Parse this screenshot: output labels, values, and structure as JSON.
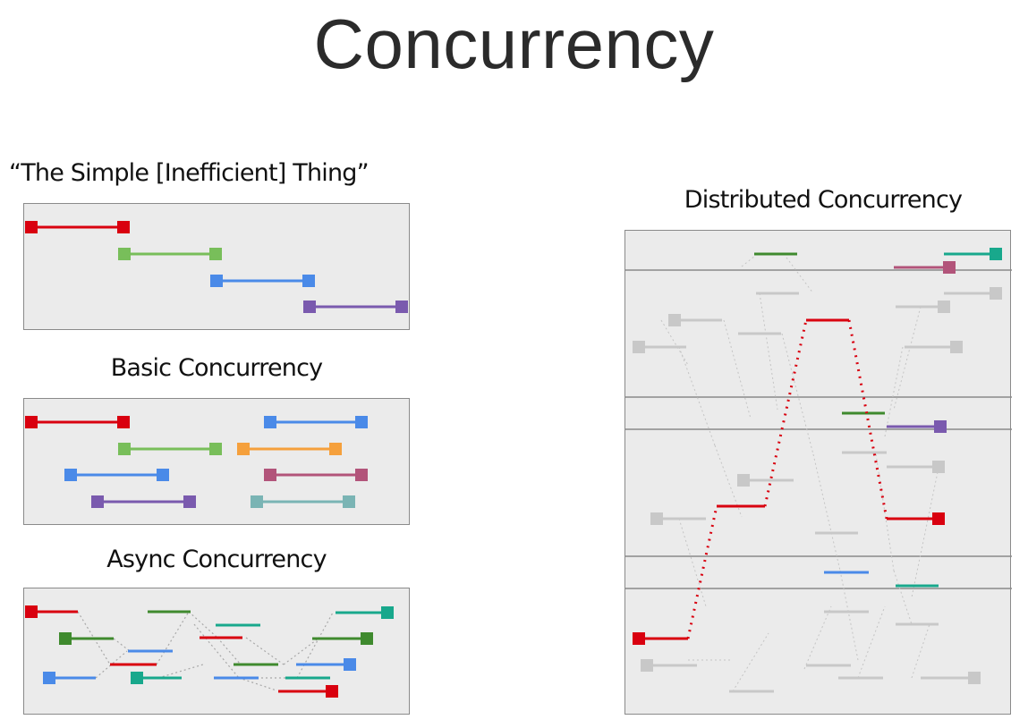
{
  "title": "Concurrency",
  "panels": {
    "simple": "“The Simple [Inefficient] Thing”",
    "basic": "Basic Concurrency",
    "async": "Async Concurrency",
    "distributed": "Distributed Concurrency"
  },
  "colors": {
    "red": "#d9000f",
    "green": "#78be5a",
    "blue": "#4a8ae8",
    "purple": "#7a5aae",
    "orange": "#f5a03c",
    "mauve": "#b2547a",
    "teal": "#7ab4b4",
    "teal_dark": "#18a88c",
    "green_dark": "#3f8a2e",
    "gray": "#c8c8c8",
    "dotted": "#a8a8a8",
    "panel_bg": "#ebebeb",
    "border": "#8a8a8a"
  }
}
